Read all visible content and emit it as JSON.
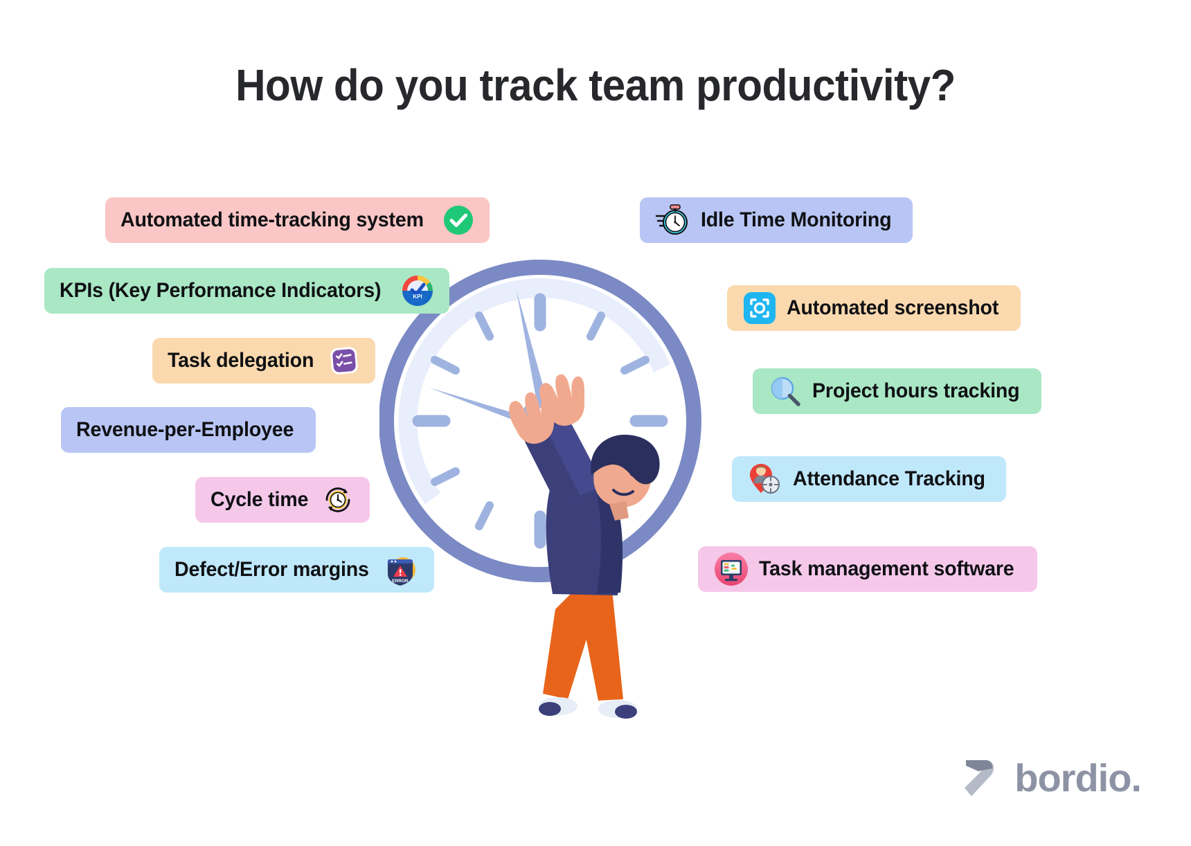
{
  "page": {
    "title": "How do you track team productivity?",
    "background": "#ffffff"
  },
  "brand": {
    "name": "bordio.",
    "logo_icon": "bordio-arrow-logo-icon",
    "color": "#8d93a5"
  },
  "illustration": {
    "name": "man-holding-giant-clock-illustration",
    "clock": {
      "rim_color": "#7b8ac4",
      "face_color": "#ffffff",
      "inner_ring_color": "#e8eefb",
      "tick_color": "#9fb3e0",
      "hand_color": "#9fb3e0",
      "minute_hand_position": "11",
      "hour_hand_position": "9"
    },
    "person": {
      "hair_color": "#2b2f5e",
      "jacket_color": "#3b3f7a",
      "pants_color": "#e8641a",
      "skin_color": "#f0a98e",
      "shoe_color": "#e6edf7"
    }
  },
  "left_column": [
    {
      "id": "automated-time",
      "label": "Automated time-tracking system",
      "bg": "#fac6c6",
      "icon": "green-check-circle-icon",
      "icon_side": "right"
    },
    {
      "id": "kpis",
      "label": "KPIs (Key Performance Indicators)",
      "bg": "#a9e7c5",
      "icon": "kpi-gauge-icon",
      "icon_side": "right"
    },
    {
      "id": "task-delegation",
      "label": "Task delegation",
      "bg": "#fbd9ae",
      "icon": "purple-checklist-icon",
      "icon_side": "right"
    },
    {
      "id": "revenue",
      "label": "Revenue-per-Employee",
      "bg": "#b9c6f5",
      "icon": null,
      "icon_side": "none"
    },
    {
      "id": "cycle-time",
      "label": "Cycle time",
      "bg": "#f5c8ea",
      "icon": "cycle-clock-arrows-icon",
      "icon_side": "right"
    },
    {
      "id": "defect",
      "label": "Defect/Error margins",
      "bg": "#bfe8fb",
      "icon": "error-warning-icon",
      "icon_side": "right"
    }
  ],
  "right_column": [
    {
      "id": "idle-time",
      "label": "Idle Time Monitoring",
      "bg": "#b9c6f5",
      "icon": "stopwatch-speed-icon",
      "icon_side": "left"
    },
    {
      "id": "screenshot",
      "label": "Automated screenshot",
      "bg": "#fbd9ae",
      "icon": "camera-focus-icon",
      "icon_side": "left"
    },
    {
      "id": "project-hours",
      "label": "Project hours tracking",
      "bg": "#a9e7c5",
      "icon": "magnifying-glass-icon",
      "icon_side": "left"
    },
    {
      "id": "attendance",
      "label": "Attendance Tracking",
      "bg": "#bfe8fb",
      "icon": "person-pin-target-icon",
      "icon_side": "left"
    },
    {
      "id": "task-management",
      "label": "Task management software",
      "bg": "#f5c8ea",
      "icon": "kanban-monitor-icon",
      "icon_side": "left"
    }
  ]
}
